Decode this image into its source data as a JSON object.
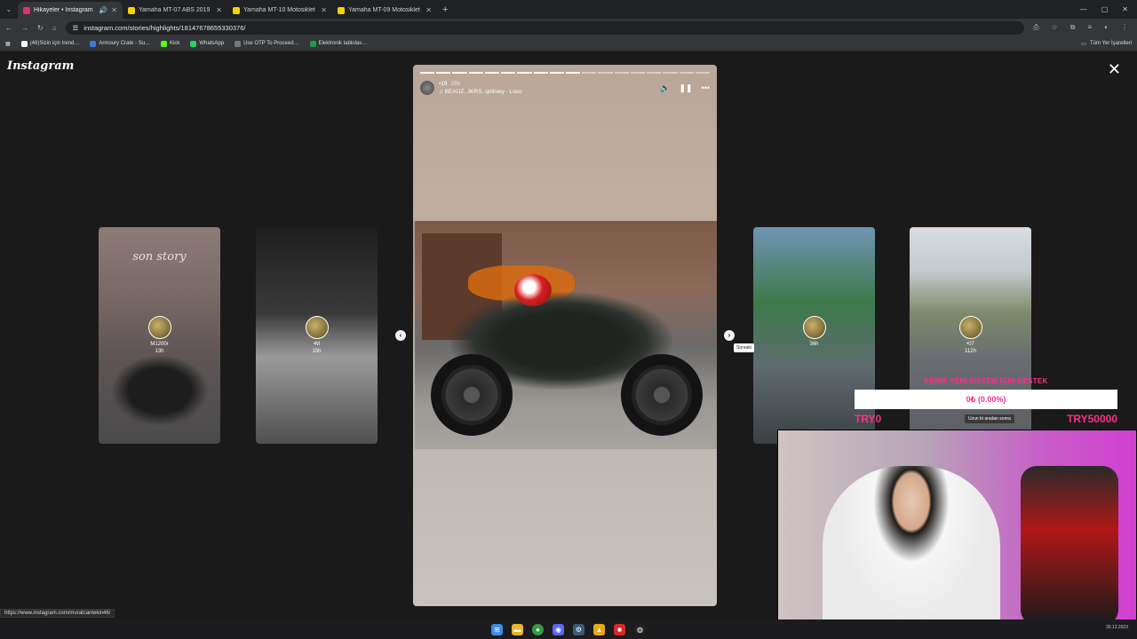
{
  "browser": {
    "tabs": [
      {
        "title": "Hikayeler • Instagram",
        "active": true,
        "favicon_color": "#e1306c"
      },
      {
        "title": "Yamaha MT-07 ABS 2019 Modi…",
        "active": false,
        "favicon_color": "#f5d300"
      },
      {
        "title": "Yamaha MT-10 Motosiklet Fiya…",
        "active": false,
        "favicon_color": "#f5d300"
      },
      {
        "title": "Yamaha MT-09 Motosiklet Fiya…",
        "active": false,
        "favicon_color": "#f5d300"
      }
    ],
    "url": "instagram.com/stories/highlights/18147678655330376/",
    "bookmarks": [
      {
        "label": "(48)Sizin için trend…",
        "color": "#ffffff"
      },
      {
        "label": "Armoury Crate - Su…",
        "color": "#3b7dd8"
      },
      {
        "label": "Kick",
        "color": "#53fc18"
      },
      {
        "label": "WhatsApp",
        "color": "#25d366"
      },
      {
        "label": "Use OTP To Proceed…",
        "color": "#777777"
      },
      {
        "label": "Elektronik tablolas…",
        "color": "#1e9e4a"
      }
    ],
    "all_bookmarks": "Tüm Yer İşaretleri"
  },
  "instagram": {
    "logo": "Instagram",
    "story": {
      "user": "•19",
      "time": "25h",
      "music": "BEAUZ, JKRS, qrilinwy · Loco",
      "segments_total": 18,
      "segments_done": 10
    },
    "side_stories": [
      {
        "label": "M1200r",
        "time": "13h",
        "overlay": "son story"
      },
      {
        "label": "•M",
        "time": "15h",
        "overlay": ""
      },
      {
        "label": "",
        "time": "36h",
        "overlay": ""
      },
      {
        "label": "•07",
        "time": "112h",
        "overlay": ""
      }
    ],
    "next_tooltip": "Sonraki"
  },
  "statusbar": {
    "url": "https://www.instagram.com/muratcantekin46/"
  },
  "overlay": {
    "donation_title": "EŞİME YENİ SİSTEM İÇİN DESTEK",
    "donation_value": "0₺ (0.00%)",
    "donation_sub": "Uzun bi aradan sonra",
    "donation_min": "TRY0",
    "donation_max": "TRY50000"
  },
  "taskbar": {
    "date": "30.12.2023"
  },
  "colors": {
    "accent": "#ff2e8a",
    "tab_bg": "#202124",
    "toolbar_bg": "#35363a"
  }
}
